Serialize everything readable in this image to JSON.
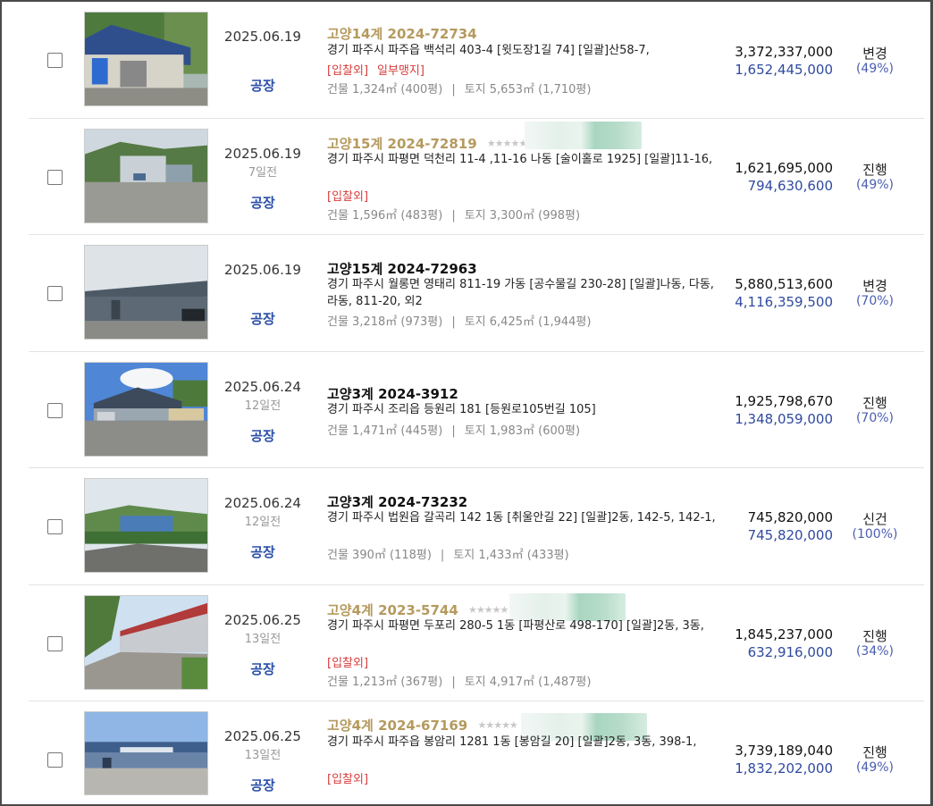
{
  "rows": [
    {
      "date": "2025.06.19",
      "ago": "",
      "kind": "공장",
      "case_court": "고양14계",
      "case_no": "2024-72734",
      "case_style": "gold",
      "stars": "",
      "blurred_name": false,
      "address": "경기 파주시 파주읍 백석리 403-4 [윗도장1길 74]  [일괄]산58-7,",
      "tags": [
        "[입찰외]",
        "일부맹지]"
      ],
      "area_building": "건물 1,324㎡ (400평)",
      "area_land": "토지 5,653㎡ (1,710평)",
      "appraisal": "3,372,337,000",
      "min_bid": "1,652,445,000",
      "status": "변경",
      "percent": "(49%)"
    },
    {
      "date": "2025.06.19",
      "ago": "7일전",
      "kind": "공장",
      "case_court": "고양15계",
      "case_no": "2024-72819",
      "case_style": "gold",
      "stars": "★★★★★",
      "blurred_name": true,
      "address": "경기 파주시 파평면 덕천리 11-4 ,11-16 나동 [술이홀로 1925]  [일괄]11-16,",
      "tags": [
        "[입찰외]"
      ],
      "area_building": "건물 1,596㎡ (483평)",
      "area_land": "토지 3,300㎡ (998평)",
      "appraisal": "1,621,695,000",
      "min_bid": "794,630,600",
      "status": "진행",
      "percent": "(49%)"
    },
    {
      "date": "2025.06.19",
      "ago": "",
      "kind": "공장",
      "case_court": "고양15계",
      "case_no": "2024-72963",
      "case_style": "dark",
      "stars": "",
      "blurred_name": false,
      "address": "경기 파주시 월롱면 영태리 811-19 가동 [공수물길 230-28]  [일괄]나동, 다동, 라동, 811-20, 외2",
      "tags": [],
      "area_building": "건물 3,218㎡ (973평)",
      "area_land": "토지 6,425㎡ (1,944평)",
      "appraisal": "5,880,513,600",
      "min_bid": "4,116,359,500",
      "status": "변경",
      "percent": "(70%)"
    },
    {
      "date": "2025.06.24",
      "ago": "12일전",
      "kind": "공장",
      "case_court": "고양3계",
      "case_no": "2024-3912",
      "case_style": "dark",
      "stars": "",
      "blurred_name": false,
      "address": "경기 파주시 조리읍 등원리 181 [등원로105번길 105]",
      "tags": [],
      "area_building": "건물 1,471㎡ (445평)",
      "area_land": "토지 1,983㎡ (600평)",
      "appraisal": "1,925,798,670",
      "min_bid": "1,348,059,000",
      "status": "진행",
      "percent": "(70%)"
    },
    {
      "date": "2025.06.24",
      "ago": "12일전",
      "kind": "공장",
      "case_court": "고양3계",
      "case_no": "2024-73232",
      "case_style": "dark",
      "stars": "",
      "blurred_name": false,
      "address": "경기 파주시 법원읍 갈곡리 142 1동 [취울안길 22]  [일괄]2동, 142-5, 142-1,",
      "tags": [],
      "area_building": "건물 390㎡ (118평)",
      "area_land": "토지 1,433㎡ (433평)",
      "appraisal": "745,820,000",
      "min_bid": "745,820,000",
      "status": "신건",
      "percent": "(100%)"
    },
    {
      "date": "2025.06.25",
      "ago": "13일전",
      "kind": "공장",
      "case_court": "고양4계",
      "case_no": "2023-5744",
      "case_style": "gold",
      "stars": "★★★★★",
      "blurred_name": true,
      "address": "경기 파주시 파평면 두포리 280-5 1동 [파평산로 498-170]  [일괄]2동, 3동,",
      "tags": [
        "[입찰외]"
      ],
      "area_building": "건물 1,213㎡ (367평)",
      "area_land": "토지 4,917㎡ (1,487평)",
      "appraisal": "1,845,237,000",
      "min_bid": "632,916,000",
      "status": "진행",
      "percent": "(34%)"
    },
    {
      "date": "2025.06.25",
      "ago": "13일전",
      "kind": "공장",
      "case_court": "고양4계",
      "case_no": "2024-67169",
      "case_style": "gold",
      "stars": "★★★★★",
      "blurred_name": true,
      "address": "경기 파주시 파주읍 봉암리 1281 1동 [봉암길 20]  [일괄]2동, 3동, 398-1,",
      "tags": [
        "[입찰외]"
      ],
      "area_building": "",
      "area_land": "",
      "appraisal": "3,739,189,040",
      "min_bid": "1,832,202,000",
      "status": "진행",
      "percent": "(49%)"
    }
  ]
}
